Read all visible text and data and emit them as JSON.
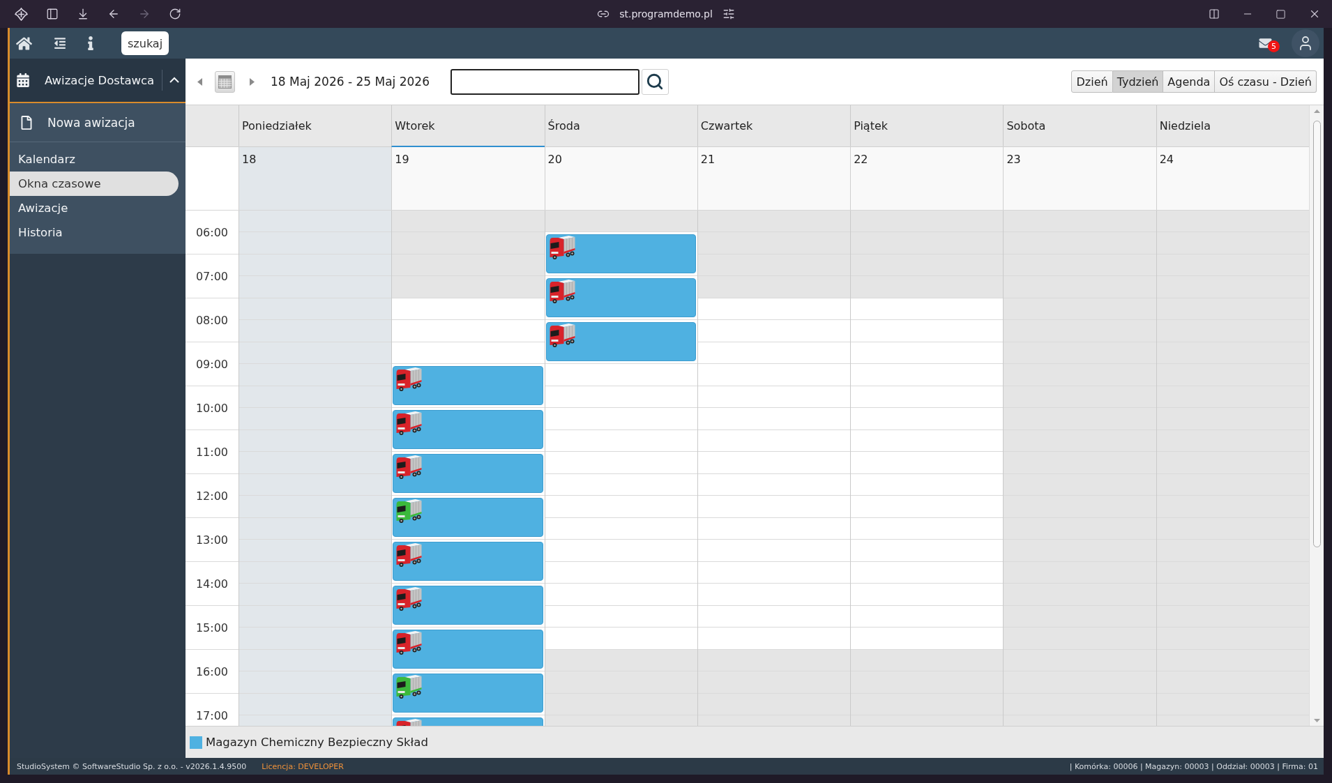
{
  "browser": {
    "url": "st.programdemo.pl",
    "forward_disabled": true
  },
  "header": {
    "search_button": "szukaj",
    "mail_badge": "5"
  },
  "sidebar": {
    "section": {
      "title": "Awizacje Dostawca",
      "expanded": true
    },
    "action": "Nowa awizacja",
    "items": [
      {
        "label": "Kalendarz",
        "selected": false
      },
      {
        "label": "Okna czasowe",
        "selected": true
      },
      {
        "label": "Awizacje",
        "selected": false
      },
      {
        "label": "Historia",
        "selected": false
      }
    ]
  },
  "toolbar": {
    "date_range": "18 Maj 2026 - 25 Maj 2026",
    "views": [
      {
        "label": "Dzień",
        "selected": false
      },
      {
        "label": "Tydzień",
        "selected": true
      },
      {
        "label": "Agenda",
        "selected": false
      },
      {
        "label": "Oś czasu - Dzień",
        "selected": false
      }
    ]
  },
  "calendar": {
    "hours": [
      "06:00",
      "07:00",
      "08:00",
      "09:00",
      "10:00",
      "11:00",
      "12:00",
      "13:00",
      "14:00",
      "15:00",
      "16:00",
      "17:00"
    ],
    "days": [
      {
        "name": "Poniedziałek",
        "date": "18",
        "today": false,
        "past": true,
        "cells": [
          {
            "kind": "slot",
            "working": false
          },
          {
            "kind": "slot",
            "working": false
          },
          {
            "kind": "slot",
            "working": false
          },
          {
            "kind": "slot",
            "working": false
          },
          {
            "kind": "slot",
            "working": false
          },
          {
            "kind": "slot",
            "working": false
          },
          {
            "kind": "slot",
            "working": false
          },
          {
            "kind": "slot",
            "working": false
          },
          {
            "kind": "slot",
            "working": false
          },
          {
            "kind": "slot",
            "working": false
          },
          {
            "kind": "slot",
            "working": false
          },
          {
            "kind": "slot",
            "working": false
          },
          {
            "kind": "slot",
            "working": false
          },
          {
            "kind": "slot",
            "working": false
          },
          {
            "kind": "slot",
            "working": false
          },
          {
            "kind": "slot",
            "working": false
          },
          {
            "kind": "slot",
            "working": false
          },
          {
            "kind": "slot",
            "working": false
          },
          {
            "kind": "slot",
            "working": false
          },
          {
            "kind": "slot",
            "working": false
          },
          {
            "kind": "slot",
            "working": false
          },
          {
            "kind": "slot",
            "working": false
          },
          {
            "kind": "slot",
            "working": false
          },
          {
            "kind": "slot",
            "working": false
          }
        ]
      },
      {
        "name": "Wtorek",
        "date": "19",
        "today": true,
        "past": false,
        "cells": [
          {
            "kind": "slot",
            "working": false
          },
          {
            "kind": "slot",
            "working": false
          },
          {
            "kind": "slot",
            "working": false
          },
          {
            "kind": "slot",
            "working": false
          },
          {
            "kind": "slot",
            "working": true
          },
          {
            "kind": "slot",
            "working": true
          },
          {
            "kind": "slot",
            "working": true
          },
          {
            "kind": "booking",
            "color": "#d8232a"
          },
          {
            "kind": "booking",
            "color": "#d8232a"
          },
          {
            "kind": "booking",
            "color": "#d8232a"
          },
          {
            "kind": "booking",
            "color": "#3cb93c"
          },
          {
            "kind": "booking",
            "color": "#d8232a"
          },
          {
            "kind": "booking",
            "color": "#d8232a"
          },
          {
            "kind": "booking",
            "color": "#d8232a"
          },
          {
            "kind": "booking",
            "color": "#3cb93c"
          },
          {
            "kind": "booking",
            "color": "#d8232a"
          }
        ]
      },
      {
        "name": "Środa",
        "date": "20",
        "today": false,
        "past": false,
        "cells": [
          {
            "kind": "slot",
            "working": false
          },
          {
            "kind": "booking",
            "color": "#d8232a"
          },
          {
            "kind": "booking",
            "color": "#d8232a"
          },
          {
            "kind": "booking",
            "color": "#d8232a"
          },
          {
            "kind": "slot",
            "working": true
          },
          {
            "kind": "slot",
            "working": true
          },
          {
            "kind": "slot",
            "working": true
          },
          {
            "kind": "slot",
            "working": true
          },
          {
            "kind": "slot",
            "working": true
          },
          {
            "kind": "slot",
            "working": true
          },
          {
            "kind": "slot",
            "working": true
          },
          {
            "kind": "slot",
            "working": true
          },
          {
            "kind": "slot",
            "working": true
          },
          {
            "kind": "slot",
            "working": true
          },
          {
            "kind": "slot",
            "working": true
          },
          {
            "kind": "slot",
            "working": true
          },
          {
            "kind": "slot",
            "working": true
          },
          {
            "kind": "slot",
            "working": false
          },
          {
            "kind": "slot",
            "working": false
          },
          {
            "kind": "slot",
            "working": false
          },
          {
            "kind": "slot",
            "working": false
          }
        ]
      },
      {
        "name": "Czwartek",
        "date": "21",
        "today": false,
        "past": false,
        "cells": [
          {
            "kind": "slot",
            "working": false
          },
          {
            "kind": "slot",
            "working": false
          },
          {
            "kind": "slot",
            "working": false
          },
          {
            "kind": "slot",
            "working": false
          },
          {
            "kind": "slot",
            "working": true
          },
          {
            "kind": "slot",
            "working": true
          },
          {
            "kind": "slot",
            "working": true
          },
          {
            "kind": "slot",
            "working": true
          },
          {
            "kind": "slot",
            "working": true
          },
          {
            "kind": "slot",
            "working": true
          },
          {
            "kind": "slot",
            "working": true
          },
          {
            "kind": "slot",
            "working": true
          },
          {
            "kind": "slot",
            "working": true
          },
          {
            "kind": "slot",
            "working": true
          },
          {
            "kind": "slot",
            "working": true
          },
          {
            "kind": "slot",
            "working": true
          },
          {
            "kind": "slot",
            "working": true
          },
          {
            "kind": "slot",
            "working": true
          },
          {
            "kind": "slot",
            "working": true
          },
          {
            "kind": "slot",
            "working": true
          },
          {
            "kind": "slot",
            "working": false
          },
          {
            "kind": "slot",
            "working": false
          },
          {
            "kind": "slot",
            "working": false
          },
          {
            "kind": "slot",
            "working": false
          }
        ]
      },
      {
        "name": "Piątek",
        "date": "22",
        "today": false,
        "past": false,
        "cells": [
          {
            "kind": "slot",
            "working": false
          },
          {
            "kind": "slot",
            "working": false
          },
          {
            "kind": "slot",
            "working": false
          },
          {
            "kind": "slot",
            "working": false
          },
          {
            "kind": "slot",
            "working": true
          },
          {
            "kind": "slot",
            "working": true
          },
          {
            "kind": "slot",
            "working": true
          },
          {
            "kind": "slot",
            "working": true
          },
          {
            "kind": "slot",
            "working": true
          },
          {
            "kind": "slot",
            "working": true
          },
          {
            "kind": "slot",
            "working": true
          },
          {
            "kind": "slot",
            "working": true
          },
          {
            "kind": "slot",
            "working": true
          },
          {
            "kind": "slot",
            "working": true
          },
          {
            "kind": "slot",
            "working": true
          },
          {
            "kind": "slot",
            "working": true
          },
          {
            "kind": "slot",
            "working": true
          },
          {
            "kind": "slot",
            "working": true
          },
          {
            "kind": "slot",
            "working": true
          },
          {
            "kind": "slot",
            "working": true
          },
          {
            "kind": "slot",
            "working": false
          },
          {
            "kind": "slot",
            "working": false
          },
          {
            "kind": "slot",
            "working": false
          },
          {
            "kind": "slot",
            "working": false
          }
        ]
      },
      {
        "name": "Sobota",
        "date": "23",
        "today": false,
        "past": false,
        "cells": [
          {
            "kind": "slot",
            "working": false
          },
          {
            "kind": "slot",
            "working": false
          },
          {
            "kind": "slot",
            "working": false
          },
          {
            "kind": "slot",
            "working": false
          },
          {
            "kind": "slot",
            "working": false
          },
          {
            "kind": "slot",
            "working": false
          },
          {
            "kind": "slot",
            "working": false
          },
          {
            "kind": "slot",
            "working": false
          },
          {
            "kind": "slot",
            "working": false
          },
          {
            "kind": "slot",
            "working": false
          },
          {
            "kind": "slot",
            "working": false
          },
          {
            "kind": "slot",
            "working": false
          },
          {
            "kind": "slot",
            "working": false
          },
          {
            "kind": "slot",
            "working": false
          },
          {
            "kind": "slot",
            "working": false
          },
          {
            "kind": "slot",
            "working": false
          },
          {
            "kind": "slot",
            "working": false
          },
          {
            "kind": "slot",
            "working": false
          },
          {
            "kind": "slot",
            "working": false
          },
          {
            "kind": "slot",
            "working": false
          },
          {
            "kind": "slot",
            "working": false
          },
          {
            "kind": "slot",
            "working": false
          },
          {
            "kind": "slot",
            "working": false
          },
          {
            "kind": "slot",
            "working": false
          }
        ]
      },
      {
        "name": "Niedziela",
        "date": "24",
        "today": false,
        "past": false,
        "cells": [
          {
            "kind": "slot",
            "working": false
          },
          {
            "kind": "slot",
            "working": false
          },
          {
            "kind": "slot",
            "working": false
          },
          {
            "kind": "slot",
            "working": false
          },
          {
            "kind": "slot",
            "working": false
          },
          {
            "kind": "slot",
            "working": false
          },
          {
            "kind": "slot",
            "working": false
          },
          {
            "kind": "slot",
            "working": false
          },
          {
            "kind": "slot",
            "working": false
          },
          {
            "kind": "slot",
            "working": false
          },
          {
            "kind": "slot",
            "working": false
          },
          {
            "kind": "slot",
            "working": false
          },
          {
            "kind": "slot",
            "working": false
          },
          {
            "kind": "slot",
            "working": false
          },
          {
            "kind": "slot",
            "working": false
          },
          {
            "kind": "slot",
            "working": false
          },
          {
            "kind": "slot",
            "working": false
          },
          {
            "kind": "slot",
            "working": false
          },
          {
            "kind": "slot",
            "working": false
          },
          {
            "kind": "slot",
            "working": false
          },
          {
            "kind": "slot",
            "working": false
          },
          {
            "kind": "slot",
            "working": false
          },
          {
            "kind": "slot",
            "working": false
          },
          {
            "kind": "slot",
            "working": false
          }
        ]
      }
    ],
    "legend": [
      {
        "label": "Magazyn Chemiczny Bezpieczny Skład",
        "color": "#4fb1e1"
      }
    ]
  },
  "status_bar": {
    "copyright": "StudioSystem © SoftwareStudio Sp. z o.o. - v2026.1.4.9500",
    "license": "Licencja: DEVELOPER",
    "location": "| Komórka: 00006 | Magazyn: 00003 | Oddział: 00003 | Firma: 01"
  }
}
